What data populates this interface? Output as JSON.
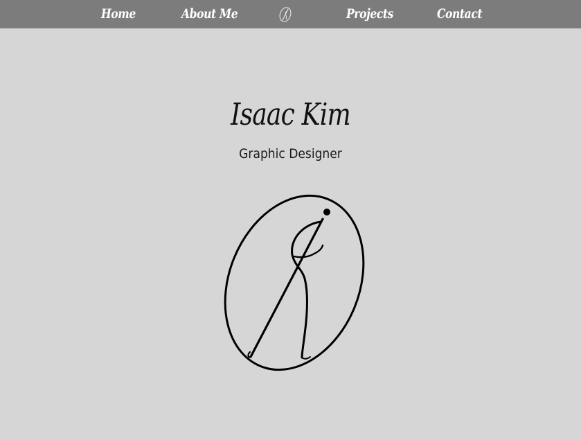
{
  "nav": {
    "items": [
      {
        "label": "Home"
      },
      {
        "label": "About Me"
      },
      {
        "label": "Projects"
      },
      {
        "label": "Contact"
      }
    ]
  },
  "hero": {
    "name": "Isaac Kim",
    "role": "Graphic Designer"
  },
  "colors": {
    "navbar": "#7c7c7c",
    "background": "#d6d6d6",
    "nav_text": "#ffffff",
    "text": "#111111"
  },
  "icons": {
    "nav_logo": "ik-monogram-icon",
    "hero_logo": "ik-monogram-logo"
  }
}
